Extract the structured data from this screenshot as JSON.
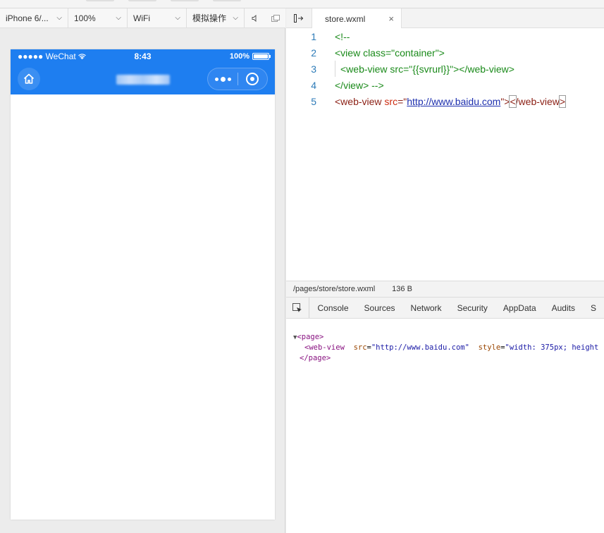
{
  "toolbar": {
    "device": "iPhone 6/...",
    "zoom": "100%",
    "network": "WiFi",
    "operation": "模拟操作"
  },
  "phone": {
    "status": {
      "carrier": "●●●●● WeChat",
      "time": "8:43",
      "battery": "100%"
    }
  },
  "editor": {
    "tab": {
      "filename": "store.wxml",
      "close": "×"
    },
    "lines": [
      {
        "n": "1",
        "parts": [
          "<!--"
        ]
      },
      {
        "n": "2",
        "parts": [
          "<view class=\"container\">"
        ]
      },
      {
        "n": "3",
        "parts": [
          "<web-view src=\"{{svrurl}}\"></web-view>"
        ]
      },
      {
        "n": "4",
        "parts": [
          "</view> -->"
        ]
      },
      {
        "n": "5",
        "parts": [
          "<web-view",
          "src",
          "=\"",
          "http://www.baidu.com",
          "\">",
          "<",
          "/web-view",
          ">"
        ]
      }
    ]
  },
  "file_status": {
    "path": "/pages/store/store.wxml",
    "size": "136 B"
  },
  "devtools": {
    "tabs": [
      "Console",
      "Sources",
      "Network",
      "Security",
      "AppData",
      "Audits",
      "S"
    ],
    "dom": {
      "open_tag": "<page>",
      "child_tag": "<web-view",
      "attr1_name": "src",
      "attr1_value": "\"http://www.baidu.com\"",
      "attr2_name": "style",
      "attr2_value": "\"width: 375px; height",
      "close_tag": "</page>"
    }
  },
  "colors": {
    "wechat_blue": "#1e7ef0"
  },
  "icons": {
    "home": "home-icon",
    "more": "more-dots-icon",
    "close": "capsule-close-icon"
  }
}
